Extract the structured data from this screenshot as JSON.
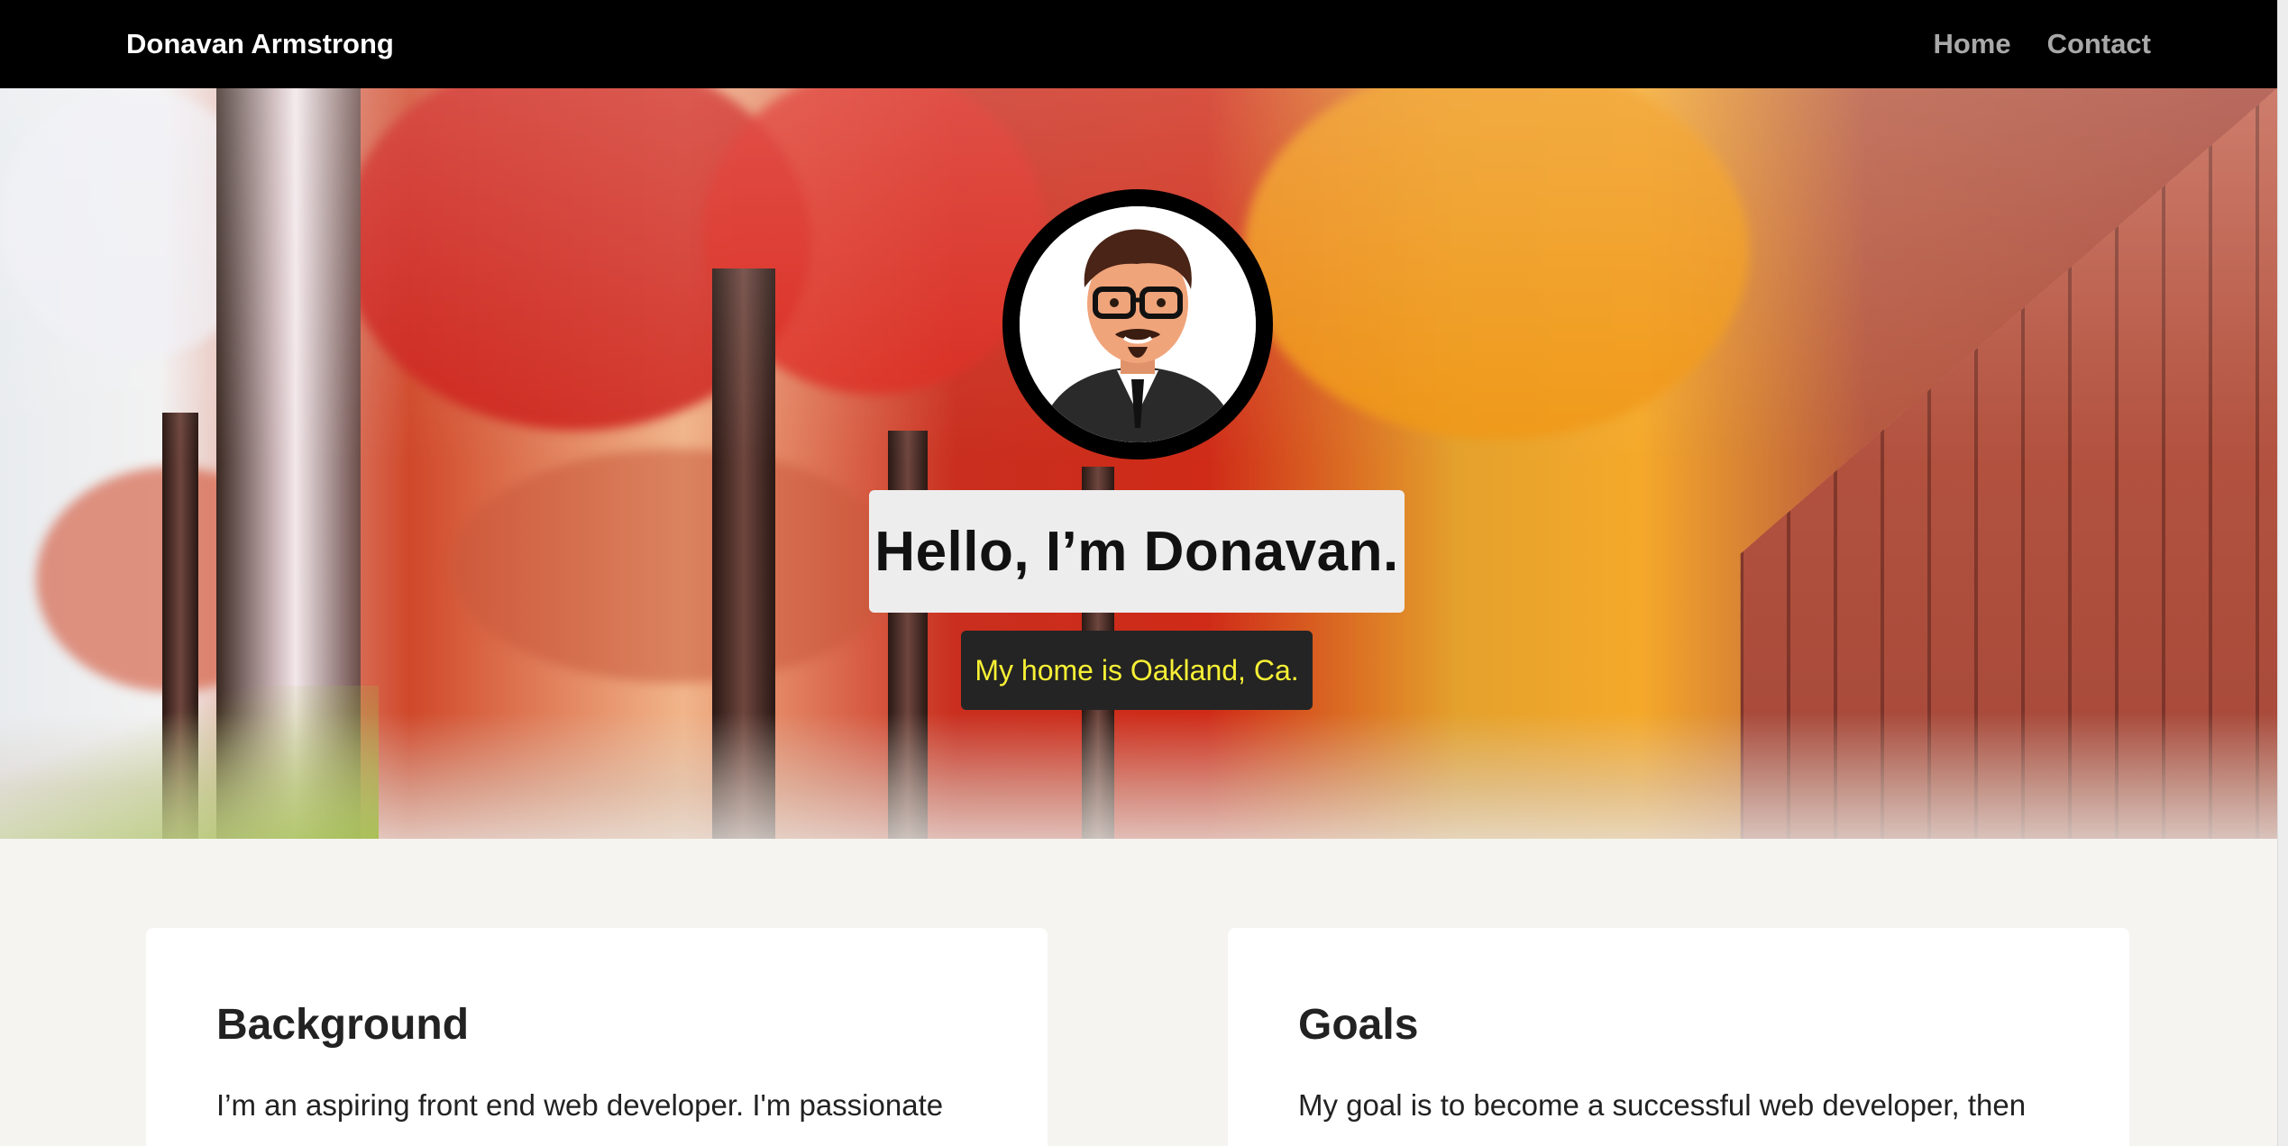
{
  "nav": {
    "brand": "Donavan Armstrong",
    "links": [
      "Home",
      "Contact"
    ]
  },
  "hero": {
    "title": "Hello, I’m Donavan.",
    "subtitle": "My home is Oakland, Ca."
  },
  "cards": [
    {
      "title": "Background",
      "text": "I’m an aspiring front end web developer. I'm passionate"
    },
    {
      "title": "Goals",
      "text": "My goal is to become a successful web developer, then"
    }
  ],
  "colors": {
    "nav_bg": "#000000",
    "nav_link": "#a8a8a8",
    "subtitle_text": "#f7f035",
    "page_bg": "#f5f4f0"
  }
}
